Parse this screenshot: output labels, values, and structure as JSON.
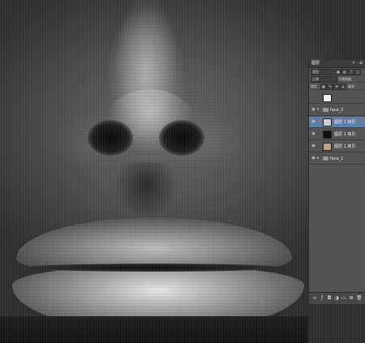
{
  "panel": {
    "tab_label": "图层",
    "filter_label": "类型",
    "blend_mode": "正常",
    "opacity_label": "不透明度",
    "lock_label": "锁定",
    "fill_label": "填充"
  },
  "layers": [
    {
      "name": "",
      "type": "layer",
      "thumb": "#eeeeee",
      "visible": false,
      "selected": false
    },
    {
      "name": "face_2",
      "type": "group",
      "thumb": "",
      "visible": true,
      "selected": false,
      "expanded": true
    },
    {
      "name": "图层 1 拷贝",
      "type": "layer",
      "thumb": "#cfcfcf",
      "visible": true,
      "selected": true
    },
    {
      "name": "图层 1 拷贝",
      "type": "layer",
      "thumb": "#111111",
      "visible": true,
      "selected": false
    },
    {
      "name": "图层 1 拷贝",
      "type": "layer",
      "thumb": "#c9a07d",
      "visible": true,
      "selected": false
    },
    {
      "name": "face_1",
      "type": "group",
      "thumb": "",
      "visible": true,
      "selected": false,
      "expanded": false
    }
  ],
  "icons": {
    "eye": "eye-icon",
    "folder": "folder-icon",
    "link": "link-icon",
    "fx": "fx-icon",
    "mask": "mask-icon",
    "adjust": "adjustment-icon",
    "new_group": "new-group-icon",
    "new_layer": "new-layer-icon",
    "delete": "trash-icon"
  }
}
